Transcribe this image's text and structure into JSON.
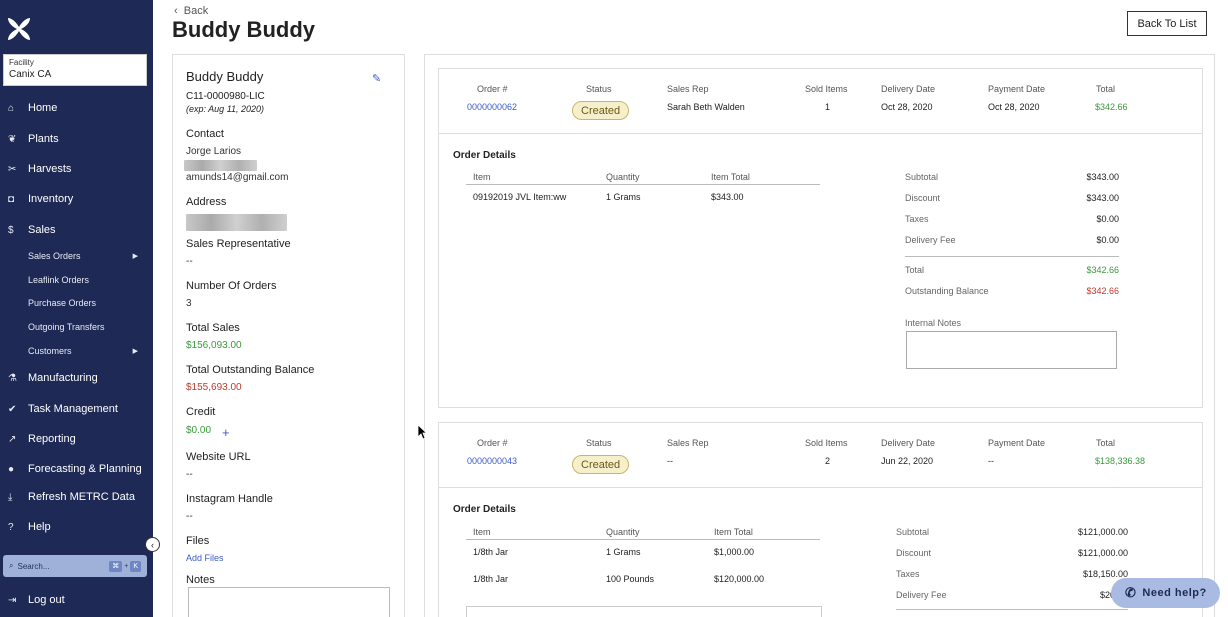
{
  "sidebar": {
    "facility_label": "Facility",
    "facility_value": "Canix CA",
    "nav": [
      {
        "label": "Home",
        "icon": "home-icon"
      },
      {
        "label": "Plants",
        "icon": "leaf-icon"
      },
      {
        "label": "Harvests",
        "icon": "scissors-icon"
      },
      {
        "label": "Inventory",
        "icon": "box-icon"
      },
      {
        "label": "Sales",
        "icon": "dollar-icon"
      },
      {
        "label": "Manufacturing",
        "icon": "flask-icon"
      },
      {
        "label": "Task Management",
        "icon": "check-icon"
      },
      {
        "label": "Reporting",
        "icon": "chart-icon"
      },
      {
        "label": "Forecasting & Planning",
        "icon": "pie-icon"
      },
      {
        "label": "Refresh METRC Data",
        "icon": "refresh-icon"
      },
      {
        "label": "Help",
        "icon": "help-icon"
      },
      {
        "label": "Log out",
        "icon": "logout-icon"
      }
    ],
    "sales_sub": [
      {
        "label": "Sales Orders"
      },
      {
        "label": "Leaflink Orders"
      },
      {
        "label": "Purchase Orders"
      },
      {
        "label": "Outgoing Transfers"
      },
      {
        "label": "Customers"
      }
    ],
    "search_placeholder": "Search...",
    "search_kbd1": "⌘",
    "search_plus": "+",
    "search_kbd2": "K"
  },
  "header": {
    "back_label": "Back",
    "title": "Buddy Buddy",
    "back_to_list": "Back To List"
  },
  "customer": {
    "name": "Buddy Buddy",
    "license": "C11-0000980-LIC",
    "expiry": "(exp: Aug 11, 2020)",
    "contact_label": "Contact",
    "contact_name": "Jorge Larios",
    "contact_email": "amunds14@gmail.com",
    "address_label": "Address",
    "sales_rep_label": "Sales Representative",
    "sales_rep_value": "--",
    "orders_label": "Number Of Orders",
    "orders_value": "3",
    "total_sales_label": "Total Sales",
    "total_sales_value": "$156,093.00",
    "outstanding_label": "Total Outstanding Balance",
    "outstanding_value": "$155,693.00",
    "credit_label": "Credit",
    "credit_value": "$0.00",
    "website_label": "Website URL",
    "website_value": "--",
    "instagram_label": "Instagram Handle",
    "instagram_value": "--",
    "files_label": "Files",
    "add_files": "Add Files",
    "notes_label": "Notes"
  },
  "order_headers": {
    "order_no": "Order #",
    "status": "Status",
    "sales_rep": "Sales Rep",
    "sold_items": "Sold Items",
    "delivery_date": "Delivery Date",
    "payment_date": "Payment Date",
    "total": "Total",
    "details_title": "Order Details",
    "item": "Item",
    "quantity": "Quantity",
    "item_total": "Item Total",
    "subtotal": "Subtotal",
    "discount": "Discount",
    "taxes": "Taxes",
    "delivery_fee": "Delivery Fee",
    "grand_total": "Total",
    "outstanding_balance": "Outstanding Balance",
    "internal_notes": "Internal Notes"
  },
  "orders": [
    {
      "order_no": "0000000062",
      "status": "Created",
      "sales_rep": "Sarah Beth Walden",
      "sold_items": "1",
      "delivery_date": "Oct 28, 2020",
      "payment_date": "Oct 28, 2020",
      "total": "$342.66",
      "items": [
        {
          "item": "09192019 JVL Item:ww",
          "quantity": "1 Grams",
          "item_total": "$343.00"
        }
      ],
      "subtotal": "$343.00",
      "discount": "$343.00",
      "taxes": "$0.00",
      "delivery_fee": "$0.00",
      "grand_total": "$342.66",
      "outstanding_balance": "$342.66"
    },
    {
      "order_no": "0000000043",
      "status": "Created",
      "sales_rep": "--",
      "sold_items": "2",
      "delivery_date": "Jun 22, 2020",
      "payment_date": "--",
      "total": "$138,336.38",
      "items": [
        {
          "item": "1/8th Jar",
          "quantity": "1 Grams",
          "item_total": "$1,000.00"
        },
        {
          "item": "1/8th Jar",
          "quantity": "100 Pounds",
          "item_total": "$120,000.00"
        }
      ],
      "subtotal": "$121,000.00",
      "discount": "$121,000.00",
      "taxes": "$18,150.00",
      "delivery_fee": "$20"
    }
  ],
  "help_button": "Need help?",
  "colors": {
    "sidebar_bg": "#1e2a55",
    "link": "#3b5cc5",
    "positive": "#3a9a3a",
    "negative": "#c0392b",
    "status_pill": "#f6efcc"
  }
}
